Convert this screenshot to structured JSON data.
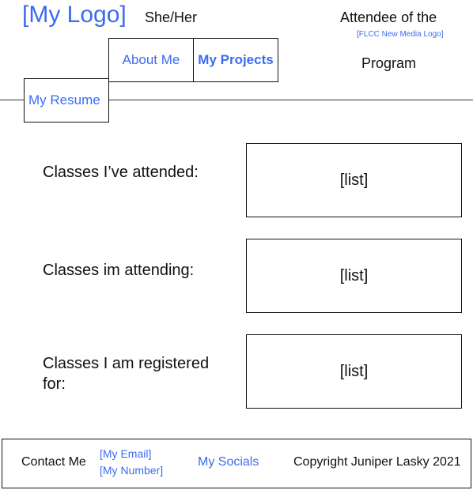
{
  "header": {
    "logo": "[My Logo]",
    "pronouns": "She/Her",
    "attendee_line1": "Attendee of the",
    "program_logo": "[FLCC New Media Logo]",
    "attendee_line2": "Program"
  },
  "nav": {
    "about": "About Me",
    "projects": "My Projects",
    "resume": "My Resume"
  },
  "main": {
    "sections": [
      {
        "label": "Classes I’ve attended:",
        "list": "[list]"
      },
      {
        "label": "Classes im attending:",
        "list": "[list]"
      },
      {
        "label": "Classes I am registered for:",
        "list": "[list]"
      }
    ]
  },
  "footer": {
    "contact_label": "Contact Me",
    "email": "[My Email]",
    "number": "[My Number]",
    "socials": "My Socials",
    "copyright": "Copyright Juniper Lasky 2021"
  },
  "colors": {
    "link": "#3b6cf0",
    "text": "#111111",
    "border": "#111111"
  }
}
